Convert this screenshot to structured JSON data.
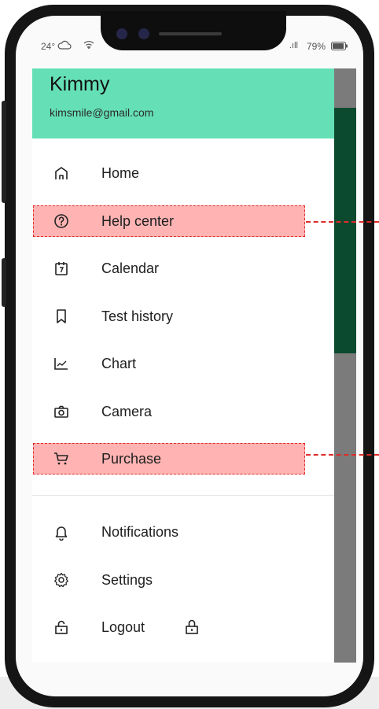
{
  "status_bar": {
    "temperature": "24°",
    "signal": ".ıll",
    "battery": "79%"
  },
  "drawer": {
    "user_name": "Kimmy",
    "user_email": "kimsmile@gmail.com"
  },
  "menu": {
    "home": "Home",
    "help_center": "Help center",
    "calendar": "Calendar",
    "test_history": "Test history",
    "chart": "Chart",
    "camera": "Camera",
    "purchase": "Purchase",
    "notifications": "Notifications",
    "settings": "Settings",
    "logout": "Logout"
  },
  "icons": {
    "home": "home-icon",
    "help_center": "help-circle-icon",
    "calendar": "calendar-icon",
    "test_history": "bookmark-icon",
    "chart": "chart-icon",
    "camera": "camera-icon",
    "purchase": "cart-icon",
    "notifications": "bell-icon",
    "settings": "gear-icon",
    "logout": "logout-icon"
  },
  "colors": {
    "header_green": "#65e0b6",
    "highlight_fill": "#ffb3b3",
    "highlight_border": "#e02b2b",
    "backdrop_green": "#0b4a2e"
  }
}
